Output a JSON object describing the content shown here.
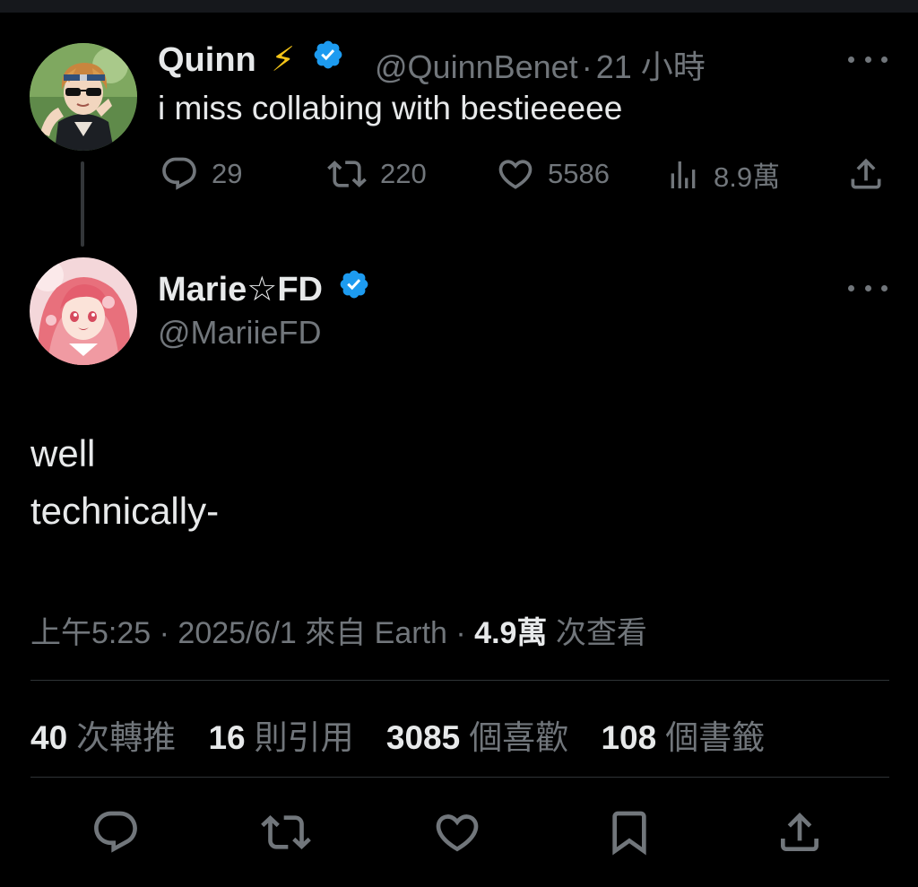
{
  "reply_parent": {
    "name": "Quinn",
    "name_emoji": "⚡",
    "handle": "@QuinnBenet",
    "separator": "·",
    "time": "21 小時",
    "text": "i miss collabing with bestieeeee",
    "metrics": {
      "replies": "29",
      "retweets": "220",
      "likes": "5586",
      "views": "8.9萬"
    }
  },
  "main_tweet": {
    "name": "Marie☆FD",
    "handle": "@MariieFD",
    "text_line1": "well",
    "text_line2": "technically-",
    "meta": {
      "time": "上午5:25",
      "date": "2025/6/1",
      "source": "來自 Earth",
      "views_num": "4.9萬",
      "views_label": "次查看"
    },
    "stats": [
      {
        "num": "40",
        "label": "次轉推"
      },
      {
        "num": "16",
        "label": "則引用"
      },
      {
        "num": "3085",
        "label": "個喜歡"
      },
      {
        "num": "108",
        "label": "個書籤"
      }
    ]
  },
  "colors": {
    "background": "#000000",
    "text": "#e7e9ea",
    "muted": "#71767b",
    "verified": "#1d9bf0",
    "divider": "#2f3336"
  },
  "icons": {
    "reply": "reply-icon",
    "retweet": "retweet-icon",
    "like": "heart-icon",
    "views": "views-icon",
    "share": "share-icon",
    "bookmark": "bookmark-icon",
    "more": "more-icon",
    "verified": "verified-badge-icon"
  }
}
